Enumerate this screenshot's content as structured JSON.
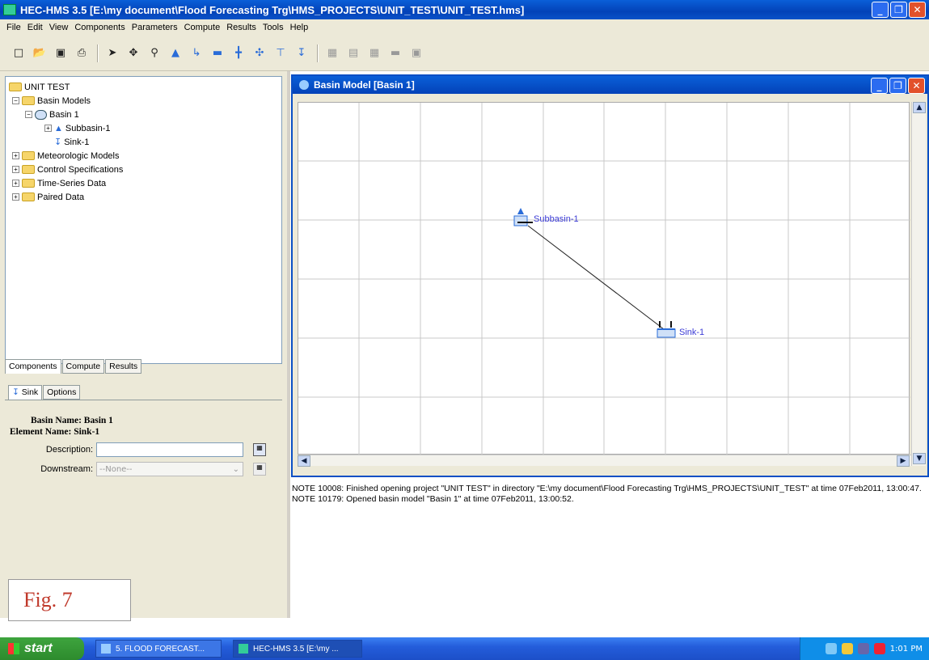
{
  "window": {
    "title": "HEC-HMS 3.5 [E:\\my document\\Flood Forecasting Trg\\HMS_PROJECTS\\UNIT_TEST\\UNIT_TEST.hms]",
    "minimize": "_",
    "restore": "❐",
    "close": "✕"
  },
  "menu": [
    "File",
    "Edit",
    "View",
    "Components",
    "Parameters",
    "Compute",
    "Results",
    "Tools",
    "Help"
  ],
  "toolbar": {
    "icons": [
      "new-icon",
      "open-icon",
      "save-icon",
      "print-icon",
      "arrow-icon",
      "pan-icon",
      "zoom-icon",
      "subbasin-icon",
      "reach-icon",
      "reservoir-icon",
      "junction-icon",
      "diversion-icon",
      "source-icon",
      "sink-icon",
      "compute-icon",
      "table-icon",
      "graph-icon",
      "summary-icon",
      "results-icon"
    ]
  },
  "tree": {
    "root": "UNIT TEST",
    "basin_models": "Basin Models",
    "basin": "Basin 1",
    "subbasin": "Subbasin-1",
    "sink": "Sink-1",
    "meteorologic": "Meteorologic Models",
    "control": "Control Specifications",
    "timeseries": "Time-Series Data",
    "paired": "Paired Data"
  },
  "left_tabs": [
    "Components",
    "Compute",
    "Results"
  ],
  "editor": {
    "tabs": [
      "Sink",
      "Options"
    ],
    "basin_name": "Basin Name: Basin 1",
    "element_name": "Element Name: Sink-1",
    "description_label": "Description:",
    "description_value": "",
    "downstream_label": "Downstream:",
    "downstream_value": "--None--"
  },
  "figure_label": "Fig. 7",
  "basin_window": {
    "title": "Basin Model [Basin 1]",
    "elements": [
      {
        "label": "Subbasin-1",
        "icon": "subbasin-icon"
      },
      {
        "label": "Sink-1",
        "icon": "sink-icon"
      }
    ]
  },
  "messages": [
    "NOTE 10008:  Finished opening project \"UNIT TEST\" in directory \"E:\\my document\\Flood Forecasting Trg\\HMS_PROJECTS\\UNIT_TEST\" at time 07Feb2011, 13:00:47.",
    "NOTE 10179:  Opened basin model \"Basin 1\" at time 07Feb2011, 13:00:52."
  ],
  "taskbar": {
    "start": "start",
    "tasks": [
      "5. FLOOD FORECAST...",
      "HEC-HMS 3.5 [E:\\my ..."
    ],
    "clock": "1:01 PM"
  }
}
